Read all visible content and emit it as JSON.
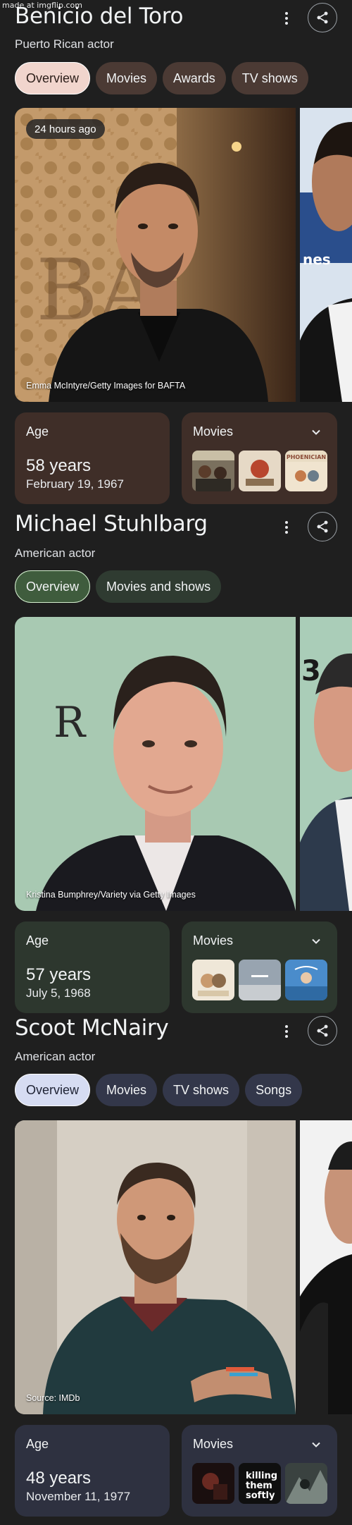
{
  "watermark": "made at imgflip.com",
  "panels": [
    {
      "name": "Benicio del Toro",
      "subtitle": "Puerto Rican actor",
      "tabs": [
        "Overview",
        "Movies",
        "Awards",
        "TV shows"
      ],
      "photo_badge": "24 hours ago",
      "photo_credit": "Emma McIntyre/Getty Images for BAFTA",
      "age_label": "Age",
      "age_value": "58 years",
      "birth_date": "February 19, 1967",
      "movies_label": "Movies",
      "poster_texts": [
        "",
        "",
        "PHOENICIAN"
      ]
    },
    {
      "name": "Michael Stuhlbarg",
      "subtitle": "American actor",
      "tabs": [
        "Overview",
        "Movies and shows"
      ],
      "photo_credit": "Kristina Bumphrey/Variety via Getty Images",
      "age_label": "Age",
      "age_value": "57 years",
      "birth_date": "July 5, 1968",
      "movies_label": "Movies"
    },
    {
      "name": "Scoot McNairy",
      "subtitle": "American actor",
      "tabs": [
        "Overview",
        "Movies",
        "TV shows",
        "Songs"
      ],
      "photo_credit": "Source: IMDb",
      "age_label": "Age",
      "age_value": "48 years",
      "birth_date": "November 11, 1977",
      "movies_label": "Movies",
      "poster_texts": [
        "",
        "killing them softly",
        ""
      ]
    }
  ],
  "icons": {
    "more": "more-vert-icon",
    "share": "share-icon",
    "expand": "chevron-down-icon"
  },
  "colors": {
    "page_bg": "#1f1f1f",
    "theme1_card": "#3f2e28",
    "theme1_chip": "#4b3a34",
    "theme2_card": "#2d372e",
    "theme2_chip": "#2f3b31",
    "theme3_card": "#2e3140",
    "theme3_chip": "#33374a"
  }
}
